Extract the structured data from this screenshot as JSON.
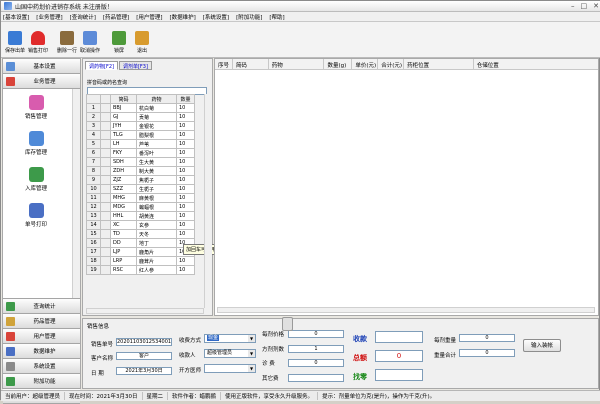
{
  "window": {
    "title": "山国中药划价进销存系统 未注册版！"
  },
  "menu": [
    "[基本设置]",
    "[业务管理]",
    "[查询统计]",
    "[药品管理]",
    "[用户管理]",
    "[数据维护]",
    "[系统设置]",
    "[附加功能]",
    "[帮助]"
  ],
  "toolbar": [
    {
      "label": "保存出单",
      "icon": "save-icon",
      "color": "#3a7bd5"
    },
    {
      "label": "销售打印",
      "icon": "heart-icon",
      "color": "#e02b2b"
    },
    {
      "label": "删除一行",
      "icon": "delete-row-icon",
      "color": "#8a6b3d"
    },
    {
      "label": "取消操作",
      "icon": "undo-icon",
      "color": "#5d8bd8"
    },
    {
      "label": "锁屏",
      "icon": "lock-screen-icon",
      "color": "#4e9a3a"
    },
    {
      "label": "退出",
      "icon": "exit-icon",
      "color": "#d89b2e"
    }
  ],
  "left": {
    "sections_top": [
      "基本设置",
      "业务管理"
    ],
    "nav": [
      "销售管理",
      "库存管理",
      "入库管理",
      "单号打印"
    ],
    "sections_bottom": [
      "查询统计",
      "药品管理",
      "用户管理",
      "数据维护",
      "系统设置",
      "附加功能",
      "帮助"
    ]
  },
  "center": {
    "tabs": [
      "调药物[F2]",
      "调剂单[F3]"
    ],
    "search_label": "拼音码或药名查询",
    "headers": [
      "简码",
      "药物",
      "数量"
    ],
    "rows": [
      [
        "1",
        "BBJ",
        "杭白菊",
        "10"
      ],
      [
        "2",
        "GJ",
        "贡菊",
        "10"
      ],
      [
        "3",
        "JYH",
        "金银花",
        "10"
      ],
      [
        "4",
        "TLG",
        "腊梨根",
        "10"
      ],
      [
        "5",
        "LH",
        "芦苇",
        "10"
      ],
      [
        "6",
        "FKY",
        "番泻叶",
        "10"
      ],
      [
        "7",
        "SDH",
        "生大黄",
        "10"
      ],
      [
        "8",
        "ZDH",
        "制大黄",
        "10"
      ],
      [
        "9",
        "ZJZ",
        "焦栀子",
        "10"
      ],
      [
        "10",
        "SZZ",
        "生栀子",
        "10"
      ],
      [
        "11",
        "MHG",
        "麻黄根",
        "10"
      ],
      [
        "12",
        "MDG",
        "蝙蝠根",
        "10"
      ],
      [
        "13",
        "HHL",
        "胡黄连",
        "10"
      ],
      [
        "14",
        "XC",
        "玄参",
        "10"
      ],
      [
        "15",
        "TD",
        "天冬",
        "10"
      ],
      [
        "16",
        "DD",
        "地丁",
        "10"
      ],
      [
        "17",
        "LJP",
        "鹿角片",
        "10"
      ],
      [
        "18",
        "LRP",
        "鹿茸片",
        "10"
      ],
      [
        "19",
        "RSC",
        "红人参",
        "10"
      ]
    ],
    "tooltip": "加回车可调用药物"
  },
  "grid_headers": [
    "序号",
    "简码",
    "药物",
    "数量(g)",
    "单价(元)",
    "合计(元)",
    "药柜位置",
    "仓储位置"
  ],
  "sales": {
    "title": "销售信息",
    "order_no_label": "销售单号",
    "order_no": "20201103012534001",
    "fee_type_label": "收费方式",
    "fee_type": "现金",
    "dose_unit_label": "每剂价格",
    "dose_unit": "0",
    "customer_label": "客户名称",
    "customer": "客户",
    "collector_label": "收款人",
    "collector": "超级管理员",
    "doses_label": "方剂剂数",
    "doses": "1",
    "date_label": "日    期",
    "date": "2021年3月30日",
    "prescriber_label": "开方医师",
    "prescriber": "",
    "diagnosis_label": "诊    费",
    "diagnosis": "0",
    "other_label": "其它费",
    "other": "",
    "receive_label": "收款",
    "receive": "",
    "total_label": "总额",
    "total": "0",
    "change_label": "找零",
    "change": "",
    "dose_weight_label": "每剂重量",
    "dose_weight": "0",
    "weight_total_label": "重量合计",
    "weight_total": "0",
    "import_btn": "输入装帐"
  },
  "status": [
    "当前用户：超级管理员",
    "现在时间：2021年3月30日",
    "星期二",
    "软件作者：蜡鹏鹂",
    "使用正版软件，享受永久升级服务。",
    "提示：剂量单位为克(是升)，操作为千克(升)。"
  ]
}
